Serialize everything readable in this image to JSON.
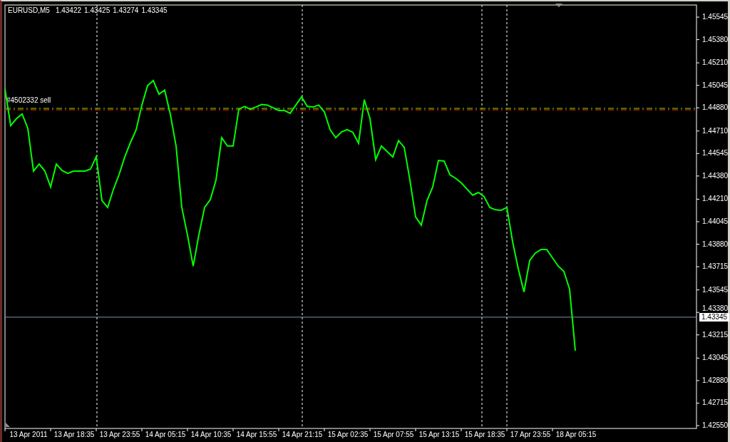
{
  "current_price": "1.43345",
  "header": {
    "symbol": "EURUSD,M5",
    "quotes": [
      "1.43422",
      "1.43425",
      "1.43274",
      "1.43345"
    ]
  },
  "chart_data": {
    "type": "line",
    "ylim": [
      1.42529,
      1.45634
    ],
    "categories": [
      null,
      null,
      null,
      null,
      "13 Apr 2011",
      null,
      null,
      null,
      null,
      null,
      null,
      null,
      "13 Apr 18:35",
      null,
      null,
      null,
      null,
      null,
      null,
      null,
      "13 Apr 23:55",
      null,
      null,
      null,
      null,
      null,
      null,
      null,
      "14 Apr 05:15",
      null,
      null,
      null,
      null,
      null,
      null,
      null,
      "14 Apr 10:35",
      null,
      null,
      null,
      null,
      null,
      null,
      null,
      "14 Apr 15:55",
      null,
      null,
      null,
      null,
      null,
      null,
      null,
      "14 Apr 21:15",
      null,
      null,
      null,
      null,
      null,
      null,
      null,
      "15 Apr 02:35",
      null,
      null,
      null,
      null,
      null,
      null,
      null,
      "15 Apr 07:55",
      null,
      null,
      null,
      null,
      null,
      null,
      null,
      "15 Apr 13:15",
      null,
      null,
      null,
      null,
      null,
      null,
      null,
      "15 Apr 18:35",
      null,
      null,
      null,
      null,
      null,
      null,
      null,
      "17 Apr 23:55",
      null,
      null,
      null,
      null,
      null,
      null,
      null,
      "18 Apr 05:15"
    ],
    "series": [
      {
        "color": "#00ff00",
        "values": [
          1.45017,
          1.4475,
          1.448,
          1.44834,
          1.4473,
          1.44416,
          1.44468,
          1.44416,
          1.443,
          1.44468,
          1.4442,
          1.444,
          1.44416,
          1.44416,
          1.44416,
          1.4443,
          1.44521,
          1.442,
          1.4415,
          1.4428,
          1.4439,
          1.4452,
          1.44625,
          1.4472,
          1.449,
          1.45043,
          1.4508,
          1.4498,
          1.4501,
          1.4483,
          1.446,
          1.4415,
          1.43946,
          1.4372,
          1.4395,
          1.4415,
          1.44207,
          1.4435,
          1.4466,
          1.446,
          1.446,
          1.4487,
          1.4489,
          1.4487,
          1.44886,
          1.44905,
          1.449,
          1.4488,
          1.4486,
          1.4486,
          1.4484,
          1.449,
          1.4496,
          1.4489,
          1.44886,
          1.449,
          1.4485,
          1.4472,
          1.4466,
          1.44703,
          1.4472,
          1.447,
          1.4462,
          1.4494,
          1.448,
          1.445,
          1.446,
          1.4456,
          1.4452,
          1.4464,
          1.4459,
          1.4435,
          1.4408,
          1.4402,
          1.442,
          1.443,
          1.44494,
          1.4449,
          1.4439,
          1.44364,
          1.4433,
          1.44285,
          1.4424,
          1.44259,
          1.4423,
          1.4415,
          1.44132,
          1.44129,
          1.4415,
          1.439,
          1.437,
          1.4353,
          1.4376,
          1.43815,
          1.43841,
          1.43841,
          1.4378,
          1.4372,
          1.4368,
          1.4355,
          1.431
        ]
      }
    ],
    "yticks": [
      {
        "value": 1.45545,
        "label": "1.45545"
      },
      {
        "value": 1.4538,
        "label": "1.45380"
      },
      {
        "value": 1.4521,
        "label": "1.45210"
      },
      {
        "value": 1.45045,
        "label": "1.45045"
      },
      {
        "value": 1.4488,
        "label": "1.44880"
      },
      {
        "value": 1.4471,
        "label": "1.44710"
      },
      {
        "value": 1.44545,
        "label": "1.44545"
      },
      {
        "value": 1.4438,
        "label": "1.44380"
      },
      {
        "value": 1.4421,
        "label": "1.44210"
      },
      {
        "value": 1.44045,
        "label": "1.44045"
      },
      {
        "value": 1.4388,
        "label": "1.43880"
      },
      {
        "value": 1.43715,
        "label": "1.43715"
      },
      {
        "value": 1.43545,
        "label": "1.43545"
      },
      {
        "value": 1.4338,
        "label": "1.43380"
      },
      {
        "value": 1.43215,
        "label": "1.43215"
      },
      {
        "value": 1.43045,
        "label": "1.43045"
      },
      {
        "value": 1.4288,
        "label": "1.42880"
      },
      {
        "value": 1.42715,
        "label": "1.42715"
      },
      {
        "value": 1.4255,
        "label": "1.42550"
      }
    ],
    "ref_lines": [
      {
        "axis": "y",
        "value": 1.44876,
        "color": "#00c000",
        "label": "#4502332 sell"
      },
      {
        "axis": "y",
        "value": 1.44866,
        "color": "#ff0000"
      },
      {
        "axis": "y",
        "value": 1.43345,
        "color": "#8090b0"
      }
    ]
  }
}
